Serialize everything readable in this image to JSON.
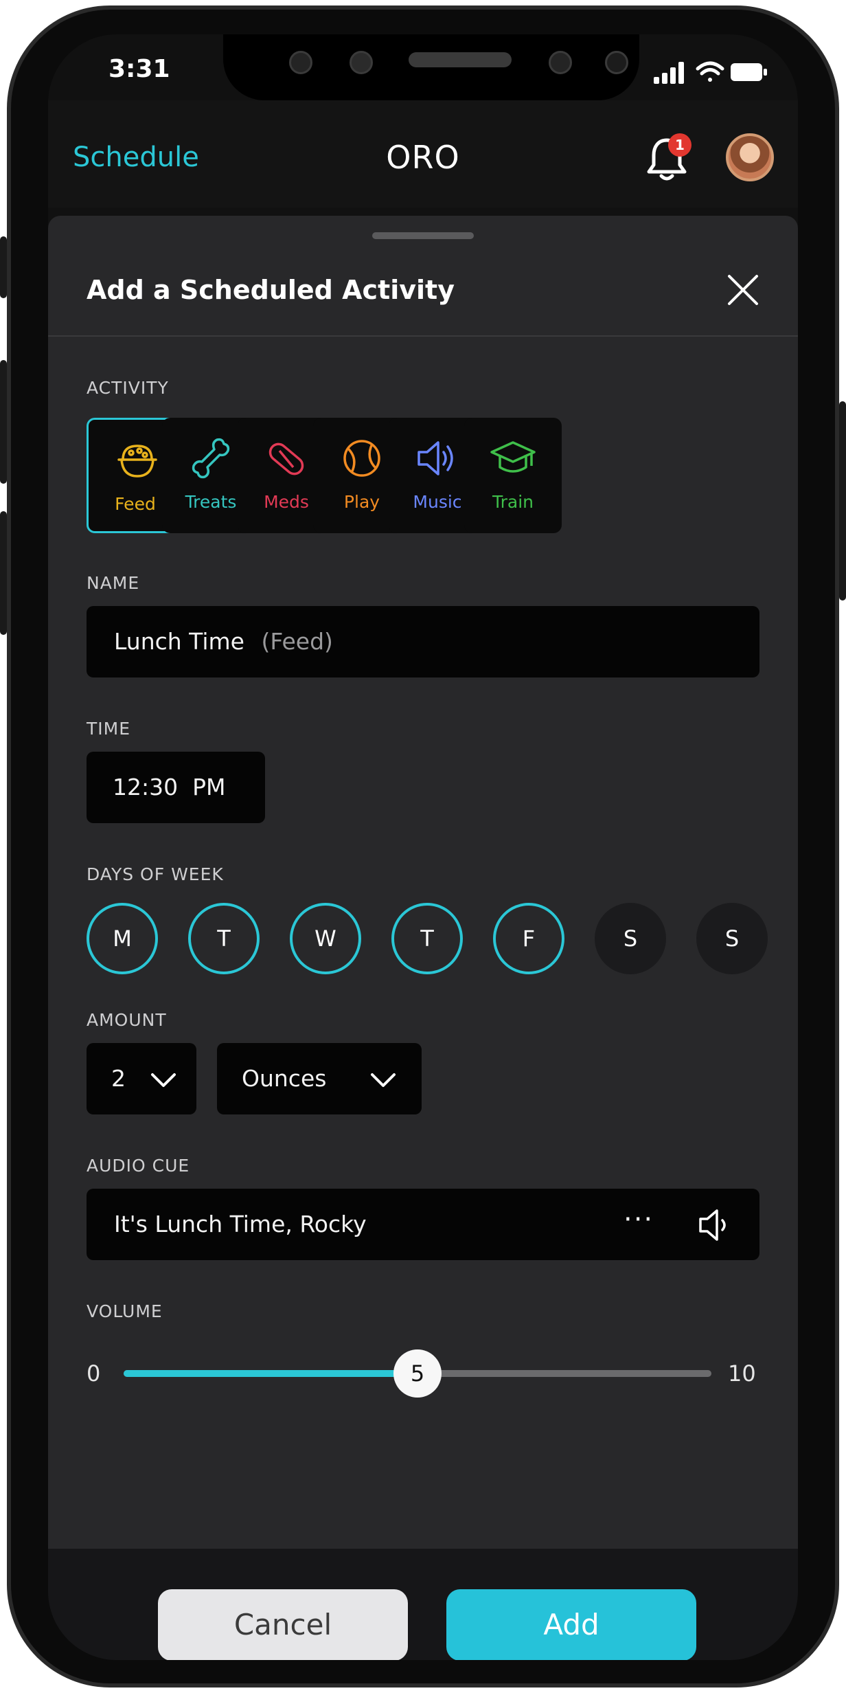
{
  "status": {
    "time": "3:31"
  },
  "nav": {
    "left": "Schedule",
    "title": "ORO",
    "notification_count": "1"
  },
  "sheet": {
    "title": "Add a Scheduled Activity"
  },
  "activity": {
    "label": "ACTIVITY",
    "items": [
      {
        "label": "Feed",
        "icon": "bowl-icon",
        "color": "#e8b21c",
        "selected": true
      },
      {
        "label": "Treats",
        "icon": "bone-icon",
        "color": "#35c6c0",
        "selected": false
      },
      {
        "label": "Meds",
        "icon": "pill-icon",
        "color": "#e23a55",
        "selected": false
      },
      {
        "label": "Play",
        "icon": "ball-icon",
        "color": "#f28b22",
        "selected": false
      },
      {
        "label": "Music",
        "icon": "speaker-icon",
        "color": "#6a86ff",
        "selected": false
      },
      {
        "label": "Train",
        "icon": "grad-cap-icon",
        "color": "#3fbf4a",
        "selected": false
      }
    ]
  },
  "name": {
    "label": "NAME",
    "value": "Lunch Time",
    "suffix": "(Feed)"
  },
  "time": {
    "label": "TIME",
    "value": "12:30  PM"
  },
  "days": {
    "label": "DAYS OF WEEK",
    "items": [
      {
        "letter": "M",
        "active": true
      },
      {
        "letter": "T",
        "active": true
      },
      {
        "letter": "W",
        "active": true
      },
      {
        "letter": "T",
        "active": true
      },
      {
        "letter": "F",
        "active": true
      },
      {
        "letter": "S",
        "active": false
      },
      {
        "letter": "S",
        "active": false
      }
    ]
  },
  "amount": {
    "label": "AMOUNT",
    "quantity": "2",
    "unit": "Ounces"
  },
  "audio": {
    "label": "AUDIO CUE",
    "value": "It's Lunch Time, Rocky",
    "more": "···"
  },
  "volume": {
    "label": "VOLUME",
    "min": "0",
    "max": "10",
    "value": "5",
    "fraction": 0.5
  },
  "buttons": {
    "cancel": "Cancel",
    "add": "Add"
  },
  "colors": {
    "accent": "#2bc7d6",
    "add_button": "#26c2d9"
  }
}
